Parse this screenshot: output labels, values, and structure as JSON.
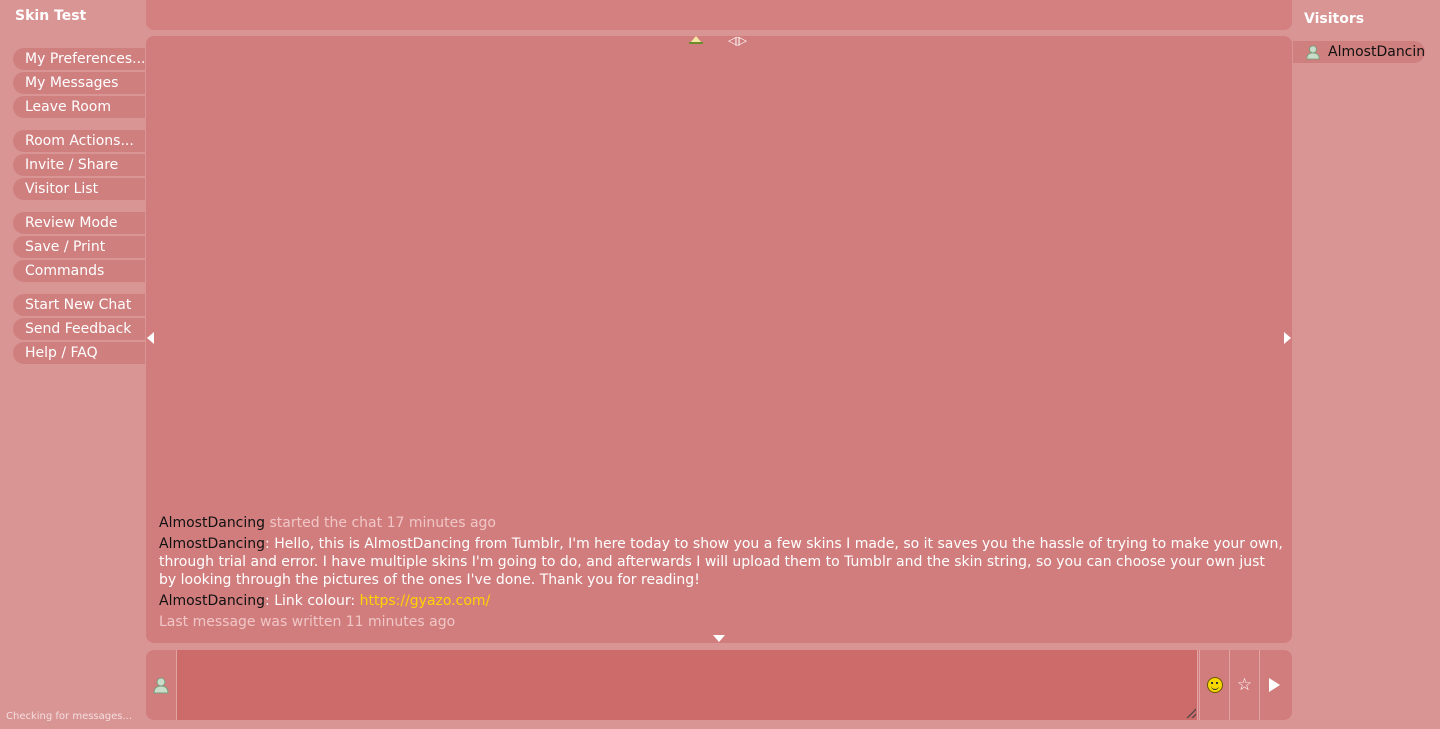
{
  "room": {
    "title": "Skin Test"
  },
  "menu": {
    "groups": [
      [
        "My Preferences...",
        "My Messages",
        "Leave Room"
      ],
      [
        "Room Actions...",
        "Invite / Share",
        "Visitor List"
      ],
      [
        "Review Mode",
        "Save / Print",
        "Commands"
      ],
      [
        "Start New Chat",
        "Send Feedback",
        "Help / FAQ"
      ]
    ]
  },
  "status": {
    "text": "Checking for messages..."
  },
  "chat": {
    "messages": [
      {
        "user": "AlmostDancing",
        "text": " started the chat 17 minutes ago",
        "type": "system"
      },
      {
        "user": "AlmostDancing",
        "text": ": Hello, this is AlmostDancing from Tumblr, I'm here today to show you a few skins I made, so it saves you the hassle of trying to make your own, through trial and error. I have multiple skins I'm going to do, and afterwards I will upload them to Tumblr and the skin string, so you can choose your own just by looking through the pictures of the ones I've done. Thank you for reading!",
        "type": "message"
      },
      {
        "user": "AlmostDancing",
        "text": ": Link colour: ",
        "link": "https://gyazo.com/",
        "type": "message"
      }
    ],
    "last_message": "Last message was written 11 minutes ago"
  },
  "visitors": {
    "title": "Visitors",
    "list": [
      "AlmostDancing"
    ]
  },
  "colors": {
    "background": "#d99494",
    "panel": "#d27d7d",
    "menu_item": "#d07f7f",
    "username": "#111111",
    "link": "#ffd400",
    "muted": "#f0c6c6"
  },
  "icons": {
    "scroll_up": "triangle-up-icon",
    "width_toggle": "resize-width-icon",
    "scroll_left": "triangle-left-icon",
    "scroll_right": "triangle-right-icon",
    "scroll_down": "triangle-down-icon",
    "avatar": "person-icon",
    "emoji": "smiley-icon",
    "favorite": "star-icon",
    "send": "send-icon"
  }
}
